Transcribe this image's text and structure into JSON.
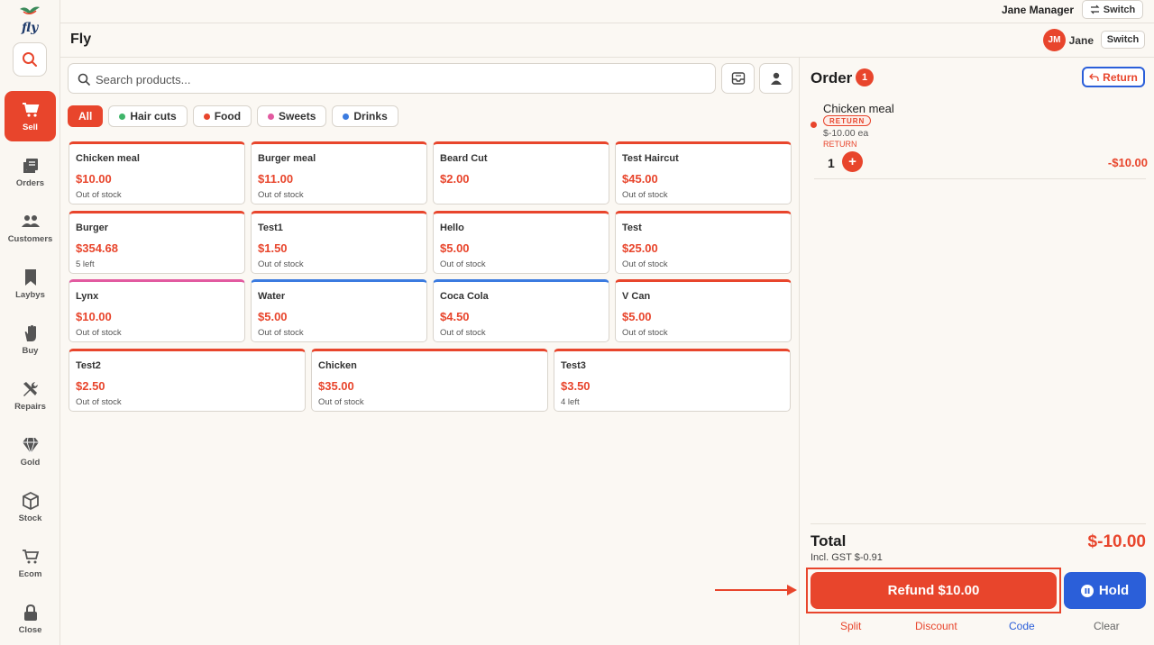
{
  "app": {
    "logo_text": "fly",
    "title": "Fly"
  },
  "topbar": {
    "user_name": "Jane Manager",
    "switch_label": "Switch"
  },
  "header": {
    "avatar_initials": "JM",
    "user_short": "Jane",
    "switch_label": "Switch"
  },
  "sidebar": {
    "items": [
      {
        "label": "Sell",
        "icon": "cart-icon",
        "active": true
      },
      {
        "label": "Orders",
        "icon": "orders-icon"
      },
      {
        "label": "Customers",
        "icon": "customers-icon"
      },
      {
        "label": "Laybys",
        "icon": "bookmark-icon"
      },
      {
        "label": "Buy",
        "icon": "hand-icon"
      },
      {
        "label": "Repairs",
        "icon": "wrench-icon"
      },
      {
        "label": "Gold",
        "icon": "diamond-icon"
      },
      {
        "label": "Stock",
        "icon": "box-icon"
      },
      {
        "label": "Ecom",
        "icon": "shop-cart-icon"
      },
      {
        "label": "Close",
        "icon": "lock-icon"
      }
    ]
  },
  "search": {
    "placeholder": "Search products..."
  },
  "categories": [
    {
      "label": "All",
      "active": true
    },
    {
      "label": "Hair cuts",
      "color": "#3fb56a"
    },
    {
      "label": "Food",
      "color": "#e8452c"
    },
    {
      "label": "Sweets",
      "color": "#e25aa0"
    },
    {
      "label": "Drinks",
      "color": "#3b7be0"
    }
  ],
  "products": [
    {
      "name": "Chicken meal",
      "price": "$10.00",
      "stock": "Out of stock",
      "color": "#e8452c"
    },
    {
      "name": "Burger meal",
      "price": "$11.00",
      "stock": "Out of stock",
      "color": "#e8452c"
    },
    {
      "name": "Beard Cut",
      "price": "$2.00",
      "stock": "",
      "color": "#e8452c"
    },
    {
      "name": "Test Haircut",
      "price": "$45.00",
      "stock": "Out of stock",
      "color": "#e8452c"
    },
    {
      "name": "Burger",
      "price": "$354.68",
      "stock": "5 left",
      "color": "#e8452c"
    },
    {
      "name": "Test1",
      "price": "$1.50",
      "stock": "Out of stock",
      "color": "#e8452c"
    },
    {
      "name": "Hello",
      "price": "$5.00",
      "stock": "Out of stock",
      "color": "#e8452c"
    },
    {
      "name": "Test",
      "price": "$25.00",
      "stock": "Out of stock",
      "color": "#e8452c"
    },
    {
      "name": "Lynx",
      "price": "$10.00",
      "stock": "Out of stock",
      "color": "#e25aa0"
    },
    {
      "name": "Water",
      "price": "$5.00",
      "stock": "Out of stock",
      "color": "#3b7be0"
    },
    {
      "name": "Coca Cola",
      "price": "$4.50",
      "stock": "Out of stock",
      "color": "#3b7be0"
    },
    {
      "name": "V Can",
      "price": "$5.00",
      "stock": "Out of stock",
      "color": "#e8452c"
    },
    {
      "name": "Test2",
      "price": "$2.50",
      "stock": "Out of stock",
      "color": "#e8452c"
    },
    {
      "name": "Chicken",
      "price": "$35.00",
      "stock": "Out of stock",
      "color": "#e8452c"
    },
    {
      "name": "Test3",
      "price": "$3.50",
      "stock": "4 left",
      "color": "#e8452c"
    }
  ],
  "order": {
    "title": "Order",
    "count": "1",
    "return_label": "Return",
    "items": [
      {
        "name": "Chicken meal",
        "badge": "RETURN",
        "unit_price": "$-10.00 ea",
        "note": "RETURN",
        "qty": "1",
        "plus": "+",
        "total": "-$10.00"
      }
    ],
    "total_label": "Total",
    "gst_text": "Incl. GST $-0.91",
    "total_value": "$-10.00",
    "refund_label": "Refund $10.00",
    "hold_label": "Hold",
    "actions": [
      "Split",
      "Discount",
      "Code",
      "Clear"
    ]
  }
}
